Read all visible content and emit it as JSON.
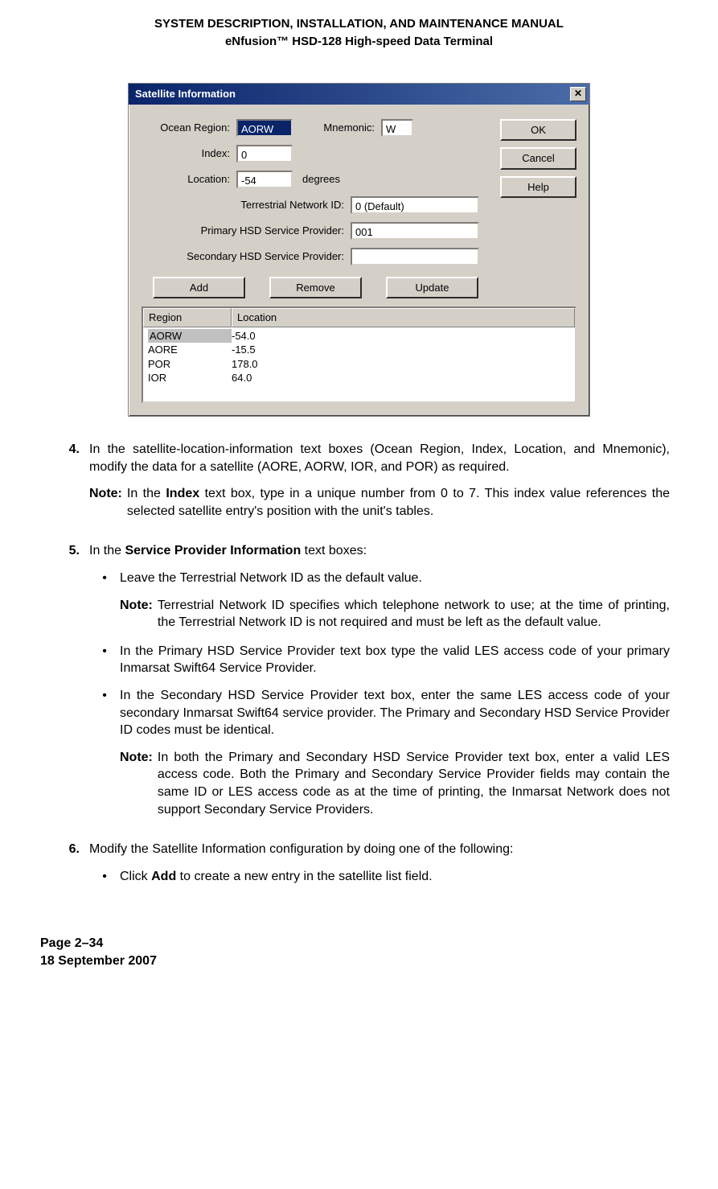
{
  "header": {
    "line1": "SYSTEM DESCRIPTION, INSTALLATION, AND MAINTENANCE MANUAL",
    "line2": "eNfusion™ HSD-128 High-speed Data Terminal"
  },
  "dialog": {
    "title": "Satellite Information",
    "labels": {
      "ocean_region": "Ocean Region:",
      "mnemonic": "Mnemonic:",
      "index": "Index:",
      "location": "Location:",
      "degrees": "degrees",
      "terrestrial": "Terrestrial Network ID:",
      "primary": "Primary HSD Service Provider:",
      "secondary": "Secondary HSD Service Provider:"
    },
    "values": {
      "ocean_region": "AORW",
      "mnemonic": "W",
      "index": "0",
      "location": "-54",
      "terrestrial": "0 (Default)",
      "primary": "001",
      "secondary": ""
    },
    "buttons": {
      "ok": "OK",
      "cancel": "Cancel",
      "help": "Help",
      "add": "Add",
      "remove": "Remove",
      "update": "Update"
    },
    "list": {
      "headers": {
        "region": "Region",
        "location": "Location"
      },
      "rows": [
        {
          "region": "AORW",
          "location": "-54.0"
        },
        {
          "region": "AORE",
          "location": "-15.5"
        },
        {
          "region": "POR",
          "location": "178.0"
        },
        {
          "region": "IOR",
          "location": "64.0"
        }
      ]
    }
  },
  "steps": {
    "s4": {
      "num": "4.",
      "text": "In the satellite-location-information text boxes (Ocean Region, Index, Location, and Mnemonic), modify the data for a satellite (AORE, AORW, IOR, and POR) as required.",
      "note_label": "Note:",
      "note_pre": "In the ",
      "note_bold": "Index",
      "note_post": " text box, type in a unique number from 0 to 7. This index value references the selected satellite entry's position with the unit's tables."
    },
    "s5": {
      "num": "5.",
      "text_pre": "In the ",
      "text_bold": "Service Provider Information",
      "text_post": " text boxes:",
      "b1": "Leave the Terrestrial Network ID as the default value.",
      "note1_label": "Note:",
      "note1": "Terrestrial Network ID specifies which telephone network to use; at the time of printing, the Terrestrial Network ID is not required and must be left as the default value.",
      "b2": "In the Primary HSD Service Provider text box type the valid LES access code of your primary Inmarsat Swift64 Service Provider.",
      "b3": "In the Secondary HSD Service Provider text box, enter the same LES access code of your secondary Inmarsat Swift64 service provider. The Primary and Secondary HSD Service Provider ID codes must be identical.",
      "note2_label": "Note:",
      "note2": "In both the Primary and Secondary HSD Service Provider text box, enter a valid LES access code. Both the Primary and Secondary Service Provider fields may contain the same ID or LES access code as at the time of printing, the Inmarsat Network does not support Secondary Service Providers."
    },
    "s6": {
      "num": "6.",
      "text": "Modify the Satellite Information configuration by doing one of the following:",
      "b1_pre": "Click ",
      "b1_bold": "Add",
      "b1_post": " to create a new entry in the satellite list field."
    }
  },
  "footer": {
    "page": "Page 2–34",
    "date": "18 September 2007"
  }
}
